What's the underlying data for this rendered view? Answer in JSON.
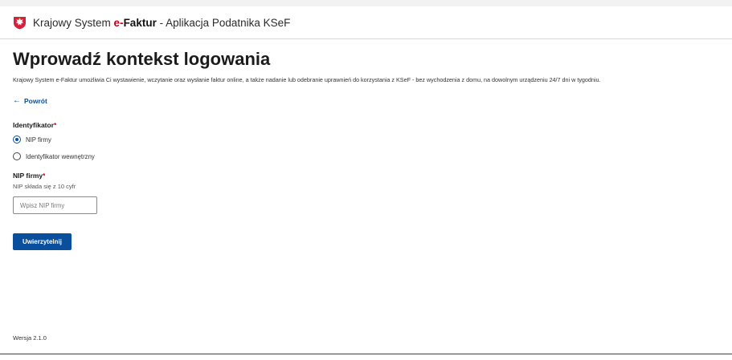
{
  "header": {
    "brand_prefix": "Krajowy System",
    "brand_e": "e-",
    "brand_faktur": "Faktur",
    "brand_suffix": " - Aplikacja Podatnika KSeF",
    "emblem_icon": "polish-eagle-emblem-icon",
    "accent_color": "#c4001a"
  },
  "main": {
    "title": "Wprowadź kontekst logowania",
    "intro": "Krajowy System e-Faktur umożliwia Ci wystawienie, wczytanie oraz wysłanie faktur online, a także nadanie lub odebranie uprawnień do korzystania z KSeF - bez wychodzenia z domu, na dowolnym urządzeniu 24/7 dni w tygodniu.",
    "back_label": "Powrót",
    "back_icon": "arrow-left-icon"
  },
  "form": {
    "identifier_label": "Identyfikator",
    "required_mark": "*",
    "options": [
      {
        "label": "NIP firmy",
        "selected": true
      },
      {
        "label": "Identyfikator wewnętrzny",
        "selected": false
      }
    ],
    "nip_label": "NIP firmy",
    "nip_hint": "NIP składa się z 10 cyfr",
    "nip_placeholder": "Wpisz NIP firmy",
    "nip_value": "",
    "submit_label": "Uwierzytelnij",
    "primary_color": "#0a4f9e"
  },
  "footer": {
    "version": "Wersja 2.1.0"
  }
}
